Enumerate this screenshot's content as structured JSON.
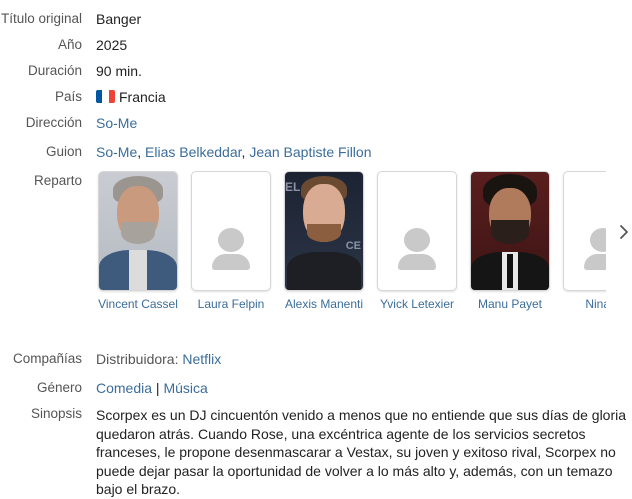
{
  "fields": {
    "titulo_label": "Título original",
    "titulo_value": "Banger",
    "anio_label": "Año",
    "anio_value": "2025",
    "duracion_label": "Duración",
    "duracion_value": "90 min.",
    "pais_label": "País",
    "pais_value": "Francia",
    "direccion_label": "Dirección",
    "direccion_value": "So-Me",
    "guion_label": "Guion",
    "guion_names": [
      "So-Me",
      "Elias Belkeddar",
      "Jean Baptiste Fillon"
    ],
    "reparto_label": "Reparto",
    "companias_label": "Compañías",
    "companias_prefix": "Distribuidora:",
    "companias_value": "Netflix",
    "genero_label": "Género",
    "genero_values": [
      "Comedia",
      "Música"
    ],
    "genero_separator": "|",
    "sinopsis_label": "Sinopsis",
    "sinopsis_value": "Scorpex es un DJ cincuentón venido a menos que no entiende que sus días de gloria quedaron atrás. Cuando Rose, una excéntrica agente de los servicios secretos franceses, le propone desenmascarar a Vestax, su joven y exitoso rival, Scorpex no puede dejar pasar la oportunidad de volver a lo más alto y, además, con un temazo bajo el brazo."
  },
  "cast": [
    {
      "name": "Vincent Cassel",
      "photo": "photo"
    },
    {
      "name": "Laura Felpin",
      "photo": "placeholder"
    },
    {
      "name": "Alexis Manenti",
      "photo": "photo"
    },
    {
      "name": "Yvick Letexier",
      "photo": "placeholder"
    },
    {
      "name": "Manu Payet",
      "photo": "photo"
    },
    {
      "name": "Nina Z",
      "photo": "placeholder"
    }
  ],
  "icons": {
    "flag": "france-flag-icon",
    "next": "chevron-right-icon",
    "placeholder": "person-placeholder-icon"
  },
  "colors": {
    "link": "#3b6d9c",
    "label": "#555555",
    "flag_blue": "#0055a4",
    "flag_white": "#ffffff",
    "flag_red": "#ef4135"
  }
}
